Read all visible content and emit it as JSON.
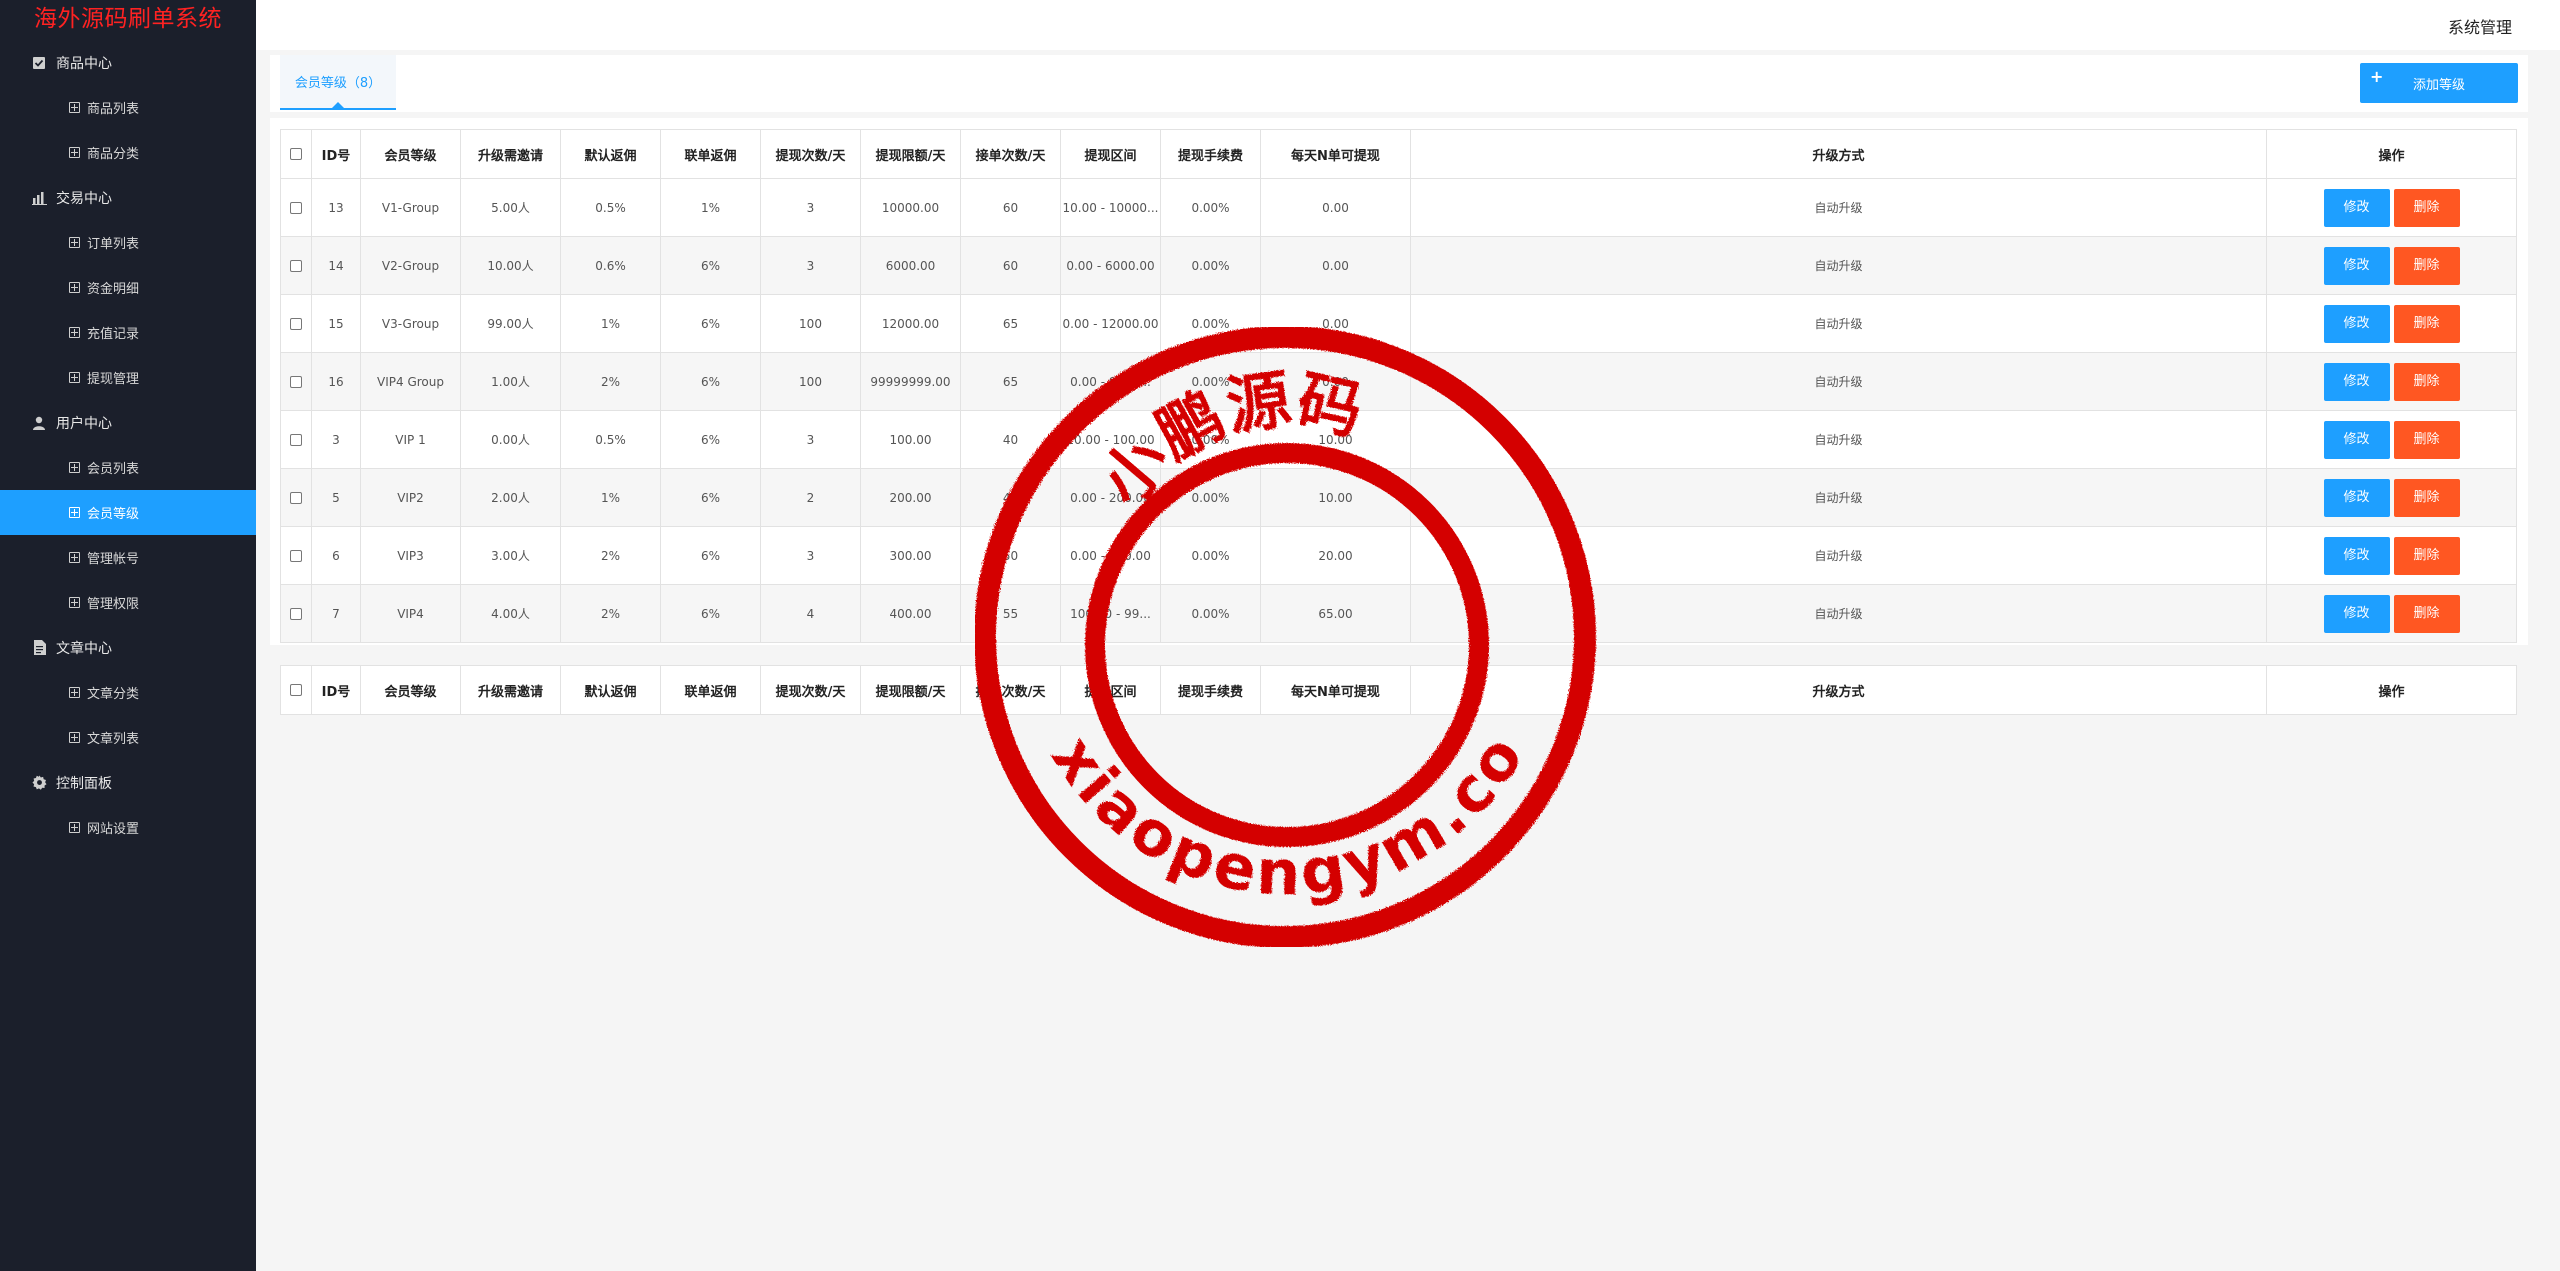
{
  "app": {
    "logo_text": "海外源码刷单系统",
    "header_right": "系统管理"
  },
  "sidebar": {
    "groups": [
      {
        "label": "商品中心",
        "icon": "checkbox-icon",
        "items": [
          {
            "label": "商品列表"
          },
          {
            "label": "商品分类"
          }
        ]
      },
      {
        "label": "交易中心",
        "icon": "bar-chart-icon",
        "items": [
          {
            "label": "订单列表"
          },
          {
            "label": "资金明细"
          },
          {
            "label": "充值记录"
          },
          {
            "label": "提现管理"
          }
        ]
      },
      {
        "label": "用户中心",
        "icon": "user-icon",
        "items": [
          {
            "label": "会员列表"
          },
          {
            "label": "会员等级",
            "active": true
          },
          {
            "label": "管理帐号"
          },
          {
            "label": "管理权限"
          }
        ]
      },
      {
        "label": "文章中心",
        "icon": "document-icon",
        "items": [
          {
            "label": "文章分类"
          },
          {
            "label": "文章列表"
          }
        ]
      },
      {
        "label": "控制面板",
        "icon": "gear-icon",
        "items": [
          {
            "label": "网站设置"
          }
        ]
      }
    ]
  },
  "tab": {
    "label": "会员等级（8）"
  },
  "toolbar": {
    "add_label": "添加等级"
  },
  "table": {
    "columns": [
      "ID号",
      "会员等级",
      "升级需邀请",
      "默认返佣",
      "联单返佣",
      "提现次数/天",
      "提现限额/天",
      "接单次数/天",
      "提现区间",
      "提现手续费",
      "每天N单可提现",
      "升级方式",
      "操作"
    ],
    "rows": [
      [
        "13",
        "V1-Group",
        "5.00人",
        "0.5%",
        "1%",
        "3",
        "10000.00",
        "60",
        "10.00 - 10000...",
        "0.00%",
        "0.00",
        "自动升级"
      ],
      [
        "14",
        "V2-Group",
        "10.00人",
        "0.6%",
        "6%",
        "3",
        "6000.00",
        "60",
        "0.00 - 6000.00",
        "0.00%",
        "0.00",
        "自动升级"
      ],
      [
        "15",
        "V3-Group",
        "99.00人",
        "1%",
        "6%",
        "100",
        "12000.00",
        "65",
        "0.00 - 12000.00",
        "0.00%",
        "0.00",
        "自动升级"
      ],
      [
        "16",
        "VIP4 Group",
        "1.00人",
        "2%",
        "6%",
        "100",
        "99999999.00",
        "65",
        "0.00 - 9999...",
        "0.00%",
        "0.00",
        "自动升级"
      ],
      [
        "3",
        "VIP 1",
        "0.00人",
        "0.5%",
        "6%",
        "3",
        "100.00",
        "40",
        "10.00 - 100.00",
        "0.00%",
        "10.00",
        "自动升级"
      ],
      [
        "5",
        "VIP2",
        "2.00人",
        "1%",
        "6%",
        "2",
        "200.00",
        "45",
        "0.00 - 200.00",
        "0.00%",
        "10.00",
        "自动升级"
      ],
      [
        "6",
        "VIP3",
        "3.00人",
        "2%",
        "6%",
        "3",
        "300.00",
        "50",
        "0.00 - 300.00",
        "0.00%",
        "20.00",
        "自动升级"
      ],
      [
        "7",
        "VIP4",
        "4.00人",
        "2%",
        "6%",
        "4",
        "400.00",
        "55",
        "100.00 - 99...",
        "0.00%",
        "65.00",
        "自动升级"
      ]
    ],
    "edit_label": "修改",
    "delete_label": "删除"
  },
  "watermark": {
    "top_text": "小鹏源码",
    "bottom_text": "xiaopengym.com"
  },
  "colors": {
    "sidebar_bg": "#1b1f2b",
    "accent": "#1e9fff",
    "danger": "#ff5722",
    "logo": "#ff2222",
    "stamp": "#d40000"
  }
}
